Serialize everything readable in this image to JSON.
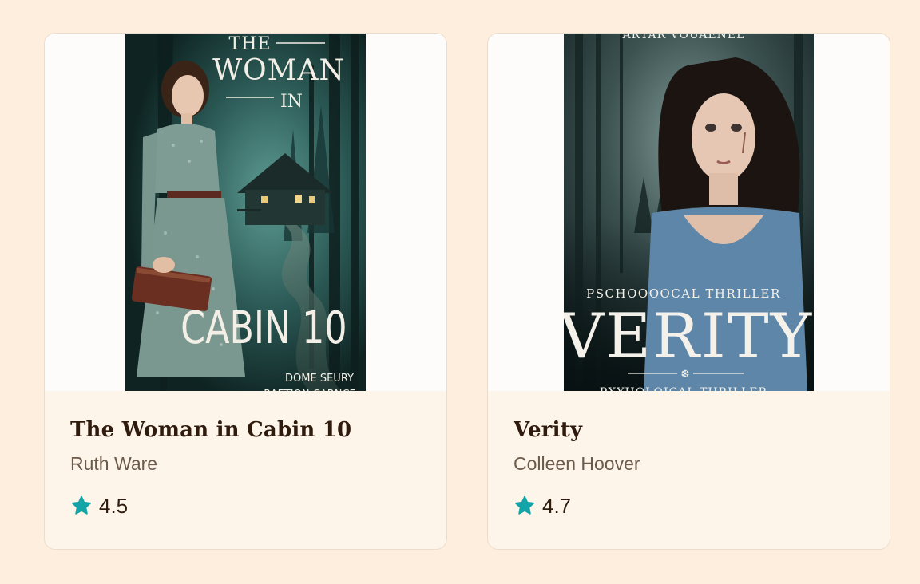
{
  "books": [
    {
      "title": "The Woman in Cabin 10",
      "author": "Ruth Ware",
      "rating": "4.5",
      "cover": {
        "top_text": "THE",
        "line2": "WOMAN",
        "line3": "IN",
        "big_title": "CABIN 10",
        "footer1": "DOME SEURY",
        "footer2": "RAETION CARNCE"
      }
    },
    {
      "title": "Verity",
      "author": "Colleen Hoover",
      "rating": "4.7",
      "cover": {
        "top_text": "ARTAR VOUAENEL",
        "tagline": "PSCHOOOOCAL THRILLER",
        "big_title": "VERITY",
        "footer": "PXYHOLOICAL THRILLER"
      }
    }
  ],
  "colors": {
    "page_bg": "#fdeedd",
    "card_bg": "#fdf5e9",
    "star": "#12a4a6",
    "title": "#2f1a0e",
    "author": "#6c5a4b"
  },
  "icons": {
    "rating": "star-icon"
  }
}
